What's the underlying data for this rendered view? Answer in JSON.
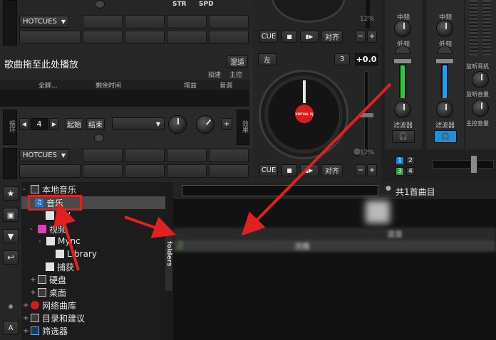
{
  "deck_top": {
    "str_label": "STR",
    "spd_label": "SPD",
    "hotcues_label": "HOTCUES",
    "cue_label": "CUE",
    "stop_symbol": "■",
    "play_symbol": "▮▶",
    "sync_label": "对齐",
    "minus": "−",
    "plus": "+",
    "pitch_percent": "12%"
  },
  "deck_bottom": {
    "drop_hint": "歌曲拖至此处播放",
    "mix_button": "混适",
    "bpm_label": "拍速",
    "key_label": "主控",
    "col_all": "全脚...",
    "col_remaining": "剩余时间",
    "col_gain": "增益",
    "col_tone": "音调",
    "loop_left": "◀",
    "loop_value": "4",
    "loop_right": "▶",
    "loop_in": "起始",
    "loop_out": "结束",
    "left_side_label": "循环",
    "right_side_label": "效果",
    "left_btn": "左",
    "deck_num": "3",
    "pitch_value": "+0.0",
    "hotcues_label": "HOTCUES",
    "cue_label": "CUE",
    "stop_symbol": "■",
    "play_symbol": "▮▶",
    "sync_label": "对齐",
    "minus": "−",
    "plus": "+",
    "pitch_percent": "12%",
    "platter_logo": "VIRTUAL DJ",
    "top_side_label": "音量"
  },
  "mixer": {
    "mid_label": "中频",
    "low_label": "低频",
    "filter_label": "滤波器",
    "mid_label_r": "中频",
    "low_label_r": "低频",
    "filter_label_r": "滤波器",
    "headphone_mix": "监听耳机",
    "headphone_volume": "监听音量",
    "master_volume": "主控音量",
    "deck1": "1",
    "deck2": "2",
    "deck3": "3",
    "deck4": "4"
  },
  "sidebar_icons": {
    "font_label": "A"
  },
  "browser_tree": {
    "items": [
      {
        "label": "本地音乐"
      },
      {
        "label": "音乐"
      },
      {
        "label": "MV"
      },
      {
        "label": "视频"
      },
      {
        "label": "Mync"
      },
      {
        "label": "Library"
      },
      {
        "label": "捕获"
      },
      {
        "label": "硬盘"
      },
      {
        "label": "桌面"
      },
      {
        "label": "网络曲库"
      },
      {
        "label": "目录和建议"
      },
      {
        "label": "筛选器"
      }
    ]
  },
  "browser": {
    "folders_tab": "folders",
    "search_placeholder": "",
    "result_count": "共1首曲目",
    "column_a": "混音",
    "row_a": "流推"
  },
  "colors": {
    "highlight_red": "#e12020",
    "green_meter": "#2ec93a",
    "blue_meter": "#1fa0ff",
    "selected_row": "#4a4a4a"
  }
}
